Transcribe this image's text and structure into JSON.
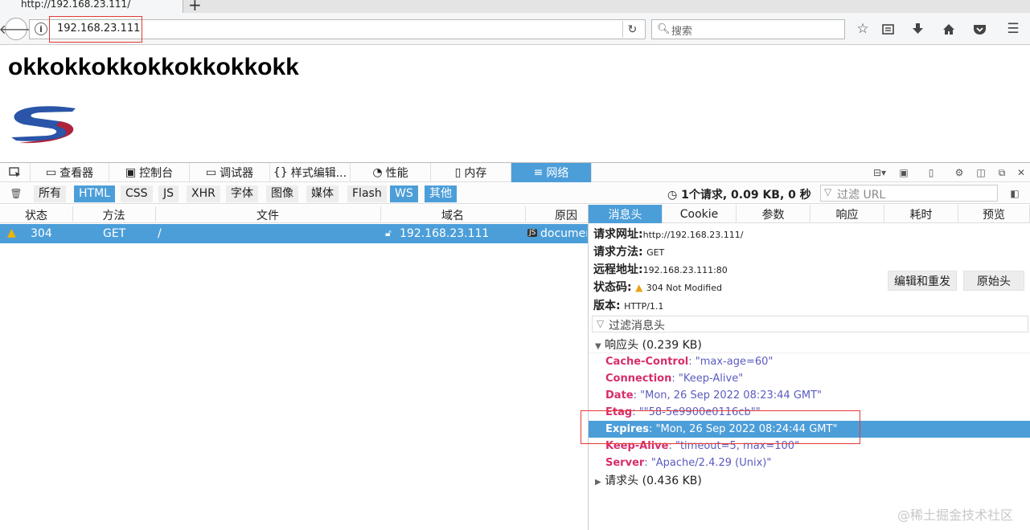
{
  "browser": {
    "tab_title": "http://192.168.23.111/",
    "new_tab": "+",
    "url": "192.168.23.111",
    "search_placeholder": "搜索"
  },
  "page": {
    "heading": "okkokkokkokkokkokkokk"
  },
  "devtools": {
    "tabs": [
      {
        "label": "查看器",
        "icon": "inspector-icon"
      },
      {
        "label": "控制台",
        "icon": "console-icon"
      },
      {
        "label": "调试器",
        "icon": "debugger-icon"
      },
      {
        "label": "样式编辑...",
        "icon": "style-editor-icon"
      },
      {
        "label": "性能",
        "icon": "performance-icon"
      },
      {
        "label": "内存",
        "icon": "memory-icon"
      },
      {
        "label": "网络",
        "icon": "network-icon"
      }
    ],
    "selected_tab": "网络",
    "filters": [
      "所有",
      "HTML",
      "CSS",
      "JS",
      "XHR",
      "字体",
      "图像",
      "媒体",
      "Flash",
      "WS",
      "其他"
    ],
    "selected_filters": [
      "HTML",
      "WS",
      "其他"
    ],
    "summary": "1个请求, 0.09 KB, 0 秒",
    "url_filter_placeholder": "过滤 URL",
    "columns": [
      "状态",
      "方法",
      "文件",
      "域名",
      "原因"
    ],
    "request": {
      "status": "304",
      "method": "GET",
      "file": "/",
      "domain": "192.168.23.111",
      "cause": "document"
    },
    "detail_tabs": [
      "消息头",
      "Cookie",
      "参数",
      "响应",
      "耗时",
      "预览"
    ],
    "selected_detail_tab": "消息头",
    "request_url_label": "请求网址:",
    "request_url": "http://192.168.23.111/",
    "request_method_label": "请求方法:",
    "request_method": "GET",
    "remote_address_label": "远程地址:",
    "remote_address": "192.168.23.111:80",
    "status_code_label": "状态码:",
    "status_code": "304  Not  Modified",
    "version_label": "版本:",
    "version": "HTTP/1.1",
    "edit_resend": "编辑和重发",
    "raw_headers": "原始头",
    "header_filter_placeholder": "过滤消息头",
    "response_headers_title": "响应头 (0.239 KB)",
    "response_headers": [
      {
        "name": "Cache-Control",
        "value": "\"max-age=60\""
      },
      {
        "name": "Connection",
        "value": "\"Keep-Alive\""
      },
      {
        "name": "Date",
        "value": "\"Mon, 26 Sep 2022 08:23:44 GMT\""
      },
      {
        "name": "Etag",
        "value": "\"\"58-5e9900e0116cb\"\""
      },
      {
        "name": "Expires",
        "value": "\"Mon, 26 Sep 2022 08:24:44 GMT\""
      },
      {
        "name": "Keep-Alive",
        "value": "\"timeout=5, max=100\""
      },
      {
        "name": "Server",
        "value": "\"Apache/2.4.29 (Unix)\""
      }
    ],
    "selected_header": "Expires",
    "request_headers_title": "请求头 (0.436 KB)"
  },
  "watermark": "@稀土掘金技术社区",
  "colors": {
    "accent": "#4c9ed9",
    "header_name": "#d62d6a",
    "header_value": "#5b5bc0",
    "annotation": "#e53935",
    "warning": "#e8a317"
  }
}
